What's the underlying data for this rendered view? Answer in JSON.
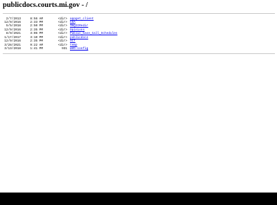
{
  "page": {
    "heading": "publicdocs.courts.mi.gov - /"
  },
  "listing": [
    {
      "date": "2/7/2013",
      "time": "8:56 AM",
      "size": "<dir>",
      "name": "appget_client"
    },
    {
      "date": "12/9/2016",
      "time": "2:33 PM",
      "size": "<dir>",
      "name": "COA"
    },
    {
      "date": "5/5/2018",
      "time": "2:50 PM",
      "size": "<dir>",
      "name": "ImgIIRedir"
    },
    {
      "date": "12/9/2016",
      "time": "2:35 PM",
      "size": "<dir>",
      "name": "Opinions"
    },
    {
      "date": "8/9/2021",
      "time": "3:06 PM",
      "size": "<dir>",
      "name": "Public_Case_Call_Schedules"
    },
    {
      "date": "1/17/2017",
      "time": "3:10 PM",
      "size": "<dir>",
      "name": "publicdocs"
    },
    {
      "date": "12/9/2016",
      "time": "2:35 PM",
      "size": "<dir>",
      "name": "SCT"
    },
    {
      "date": "3/28/2021",
      "time": "9:22 AM",
      "size": "<dir>",
      "name": "temp"
    },
    {
      "date": "3/13/2018",
      "time": "1:41 PM",
      "size": "931",
      "name": "web.config"
    }
  ]
}
